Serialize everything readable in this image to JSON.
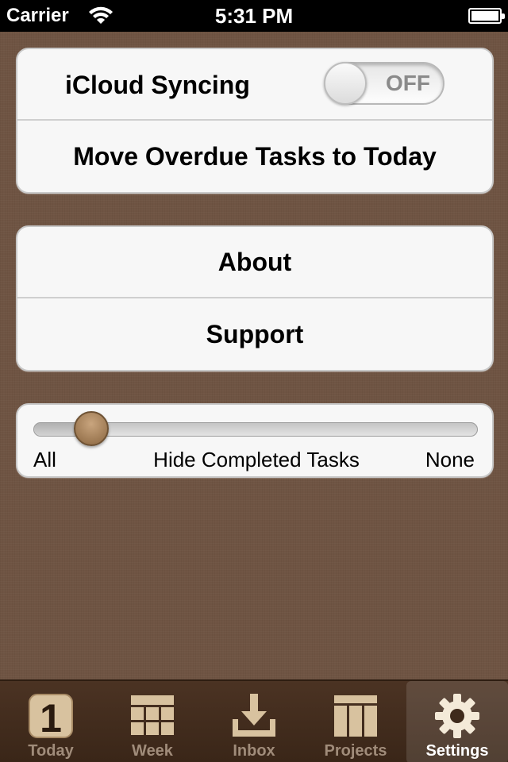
{
  "status_bar": {
    "carrier": "Carrier",
    "time": "5:31 PM",
    "wifi_icon": "wifi-icon",
    "battery_icon": "battery-icon"
  },
  "settings": {
    "icloud": {
      "label": "iCloud Syncing",
      "toggle_text": "OFF",
      "enabled": false
    },
    "move_overdue_label": "Move Overdue Tasks to Today",
    "about_label": "About",
    "support_label": "Support",
    "hide_completed": {
      "label": "Hide Completed Tasks",
      "min_label": "All",
      "max_label": "None",
      "value": 0.13
    }
  },
  "tabbar": {
    "tabs": [
      {
        "label": "Today",
        "icon": "calendar-day-icon",
        "day_number": "1",
        "selected": false
      },
      {
        "label": "Week",
        "icon": "week-grid-icon",
        "selected": false
      },
      {
        "label": "Inbox",
        "icon": "inbox-download-icon",
        "selected": false
      },
      {
        "label": "Projects",
        "icon": "projects-columns-icon",
        "selected": false
      },
      {
        "label": "Settings",
        "icon": "gear-icon",
        "selected": true
      }
    ]
  },
  "colors": {
    "background": "#6f5443",
    "tabbar": "#3a2618",
    "slider_knob": "#a67f57",
    "tab_icon_inactive": "#d8c29f"
  }
}
